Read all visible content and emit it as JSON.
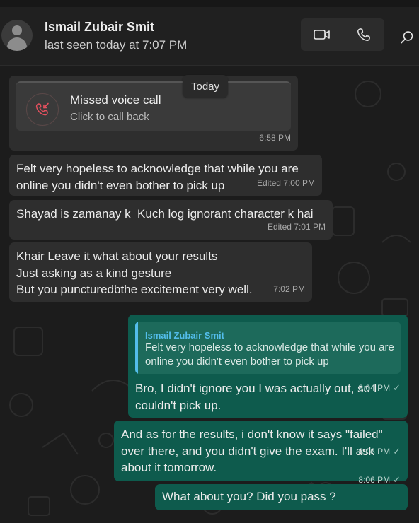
{
  "header": {
    "contact_name": "Ismail Zubair Smit",
    "status": "last seen today at 7:07 PM",
    "icons": [
      "avatar-placeholder",
      "video-call-icon",
      "voice-call-icon",
      "search-icon"
    ]
  },
  "date_divider": "Today",
  "colors": {
    "incoming_bubble": "#2e2e2e",
    "outgoing_bubble": "#0e5b4d",
    "quote_accent": "#53bdeb",
    "missed_call": "#e2505e"
  },
  "messages": {
    "missed_call": {
      "title": "Missed voice call",
      "subtitle": "Click to call back",
      "time": "6:58 PM"
    },
    "m1": {
      "text": "Felt very hopeless to acknowledge that while you are\nonline you didn't even bother to pick up",
      "meta": "Edited 7:00 PM"
    },
    "m2": {
      "text": "Shayad is zamanay k  Kuch log ignorant character k hai",
      "meta": "Edited 7:01 PM"
    },
    "m3": {
      "text": "Khair Leave it what about your results\nJust asking as a kind gesture\nBut you puncturedbthe excitement very well.",
      "meta": "7:02 PM"
    },
    "r1": {
      "quote_name": "Ismail Zubair Smit",
      "quote_text": "Felt very hopeless to acknowledge that while you are\nonline you didn't even bother to pick up",
      "text": "Bro, I didn't ignore you I was actually out, so I\ncouldn't pick up.",
      "meta": "8:04 PM"
    },
    "r2": {
      "text": "And as for the results, i don't know it says \"failed\"\nover there, and you didn't give the exam. I'll ask\nabout it tomorrow.",
      "meta": "8:06 PM"
    },
    "r3": {
      "text": "What about you? Did you pass ?",
      "meta": "8:06 PM"
    }
  }
}
